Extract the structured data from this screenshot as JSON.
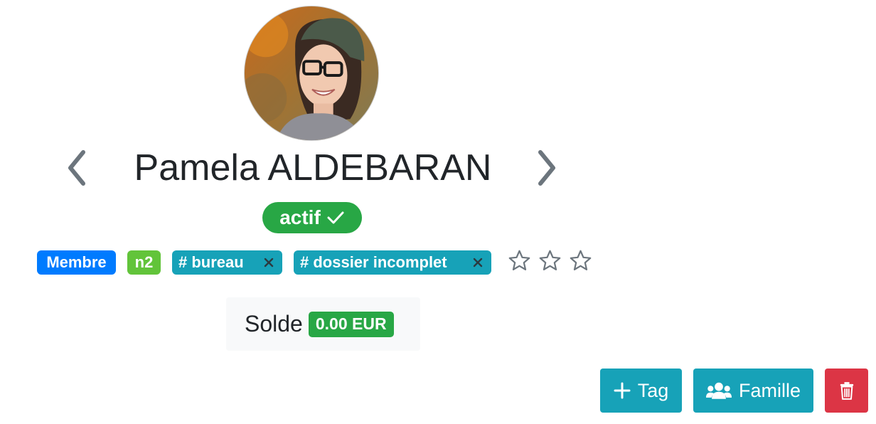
{
  "profile": {
    "name": "Pamela ALDEBARAN",
    "status": "actif",
    "avatar_icon": "person-photo"
  },
  "navigation": {
    "prev_icon": "chevron-left-icon",
    "next_icon": "chevron-right-icon"
  },
  "tags": {
    "membre": "Membre",
    "level": "n2",
    "bureau": "# bureau",
    "dossier": "# dossier incomplet"
  },
  "rating": {
    "max": 5,
    "value": 0,
    "stars_shown": 3
  },
  "balance": {
    "label": "Solde",
    "amount": "0.00 EUR"
  },
  "actions": {
    "tag_label": "Tag",
    "famille_label": "Famille",
    "delete_icon": "trash-icon"
  },
  "colors": {
    "primary": "#007bff",
    "success": "#28a745",
    "info": "#17a2b8",
    "danger": "#dc3545",
    "level_green": "#62c43a"
  }
}
